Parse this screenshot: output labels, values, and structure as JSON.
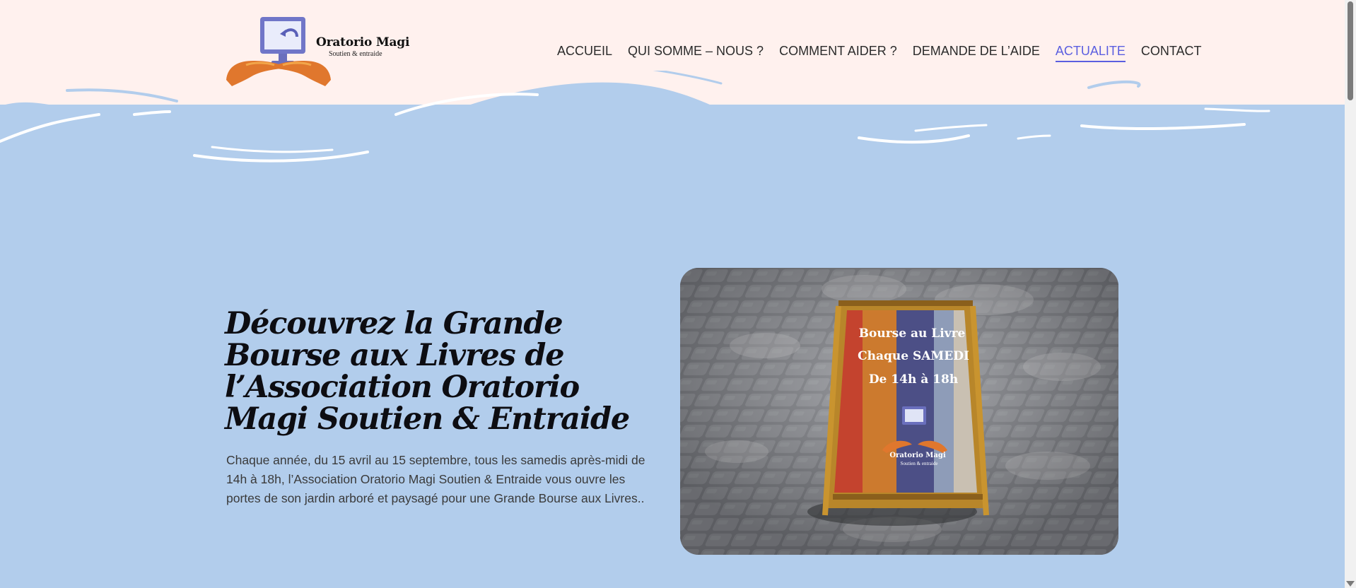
{
  "brand": {
    "name": "Oratorio Magi",
    "tagline": "Soutien & entraide"
  },
  "nav": {
    "items": [
      {
        "label": "ACCUEIL"
      },
      {
        "label": "QUI SOMME – NOUS ?"
      },
      {
        "label": "COMMENT AIDER ?"
      },
      {
        "label": "DEMANDE DE L’AIDE"
      },
      {
        "label": "ACTUALITE",
        "active": true
      },
      {
        "label": "CONTACT"
      }
    ]
  },
  "hero": {
    "headline": "Découvrez la Grande Bourse aux Livres de l’Association Oratorio Magi Soutien & Entraide",
    "lead": "Chaque année, du 15 avril au 15 septembre, tous les samedis après-midi de 14h à 18h, l’Association Oratorio Magi Soutien & Entraide vous ouvre les portes de son jardin arboré et paysagé pour une Grande Bourse aux Livres..",
    "sign": {
      "line1": "Bourse au Livre",
      "line2": "Chaque SAMEDI",
      "line3": "De 14h à 18h",
      "brand": "Oratorio Magi",
      "tagline": "Soutien & entraide"
    }
  },
  "colors": {
    "header_bg": "#fff1ee",
    "hero_bg": "#b2cdec",
    "accent": "#5b5fe0"
  }
}
